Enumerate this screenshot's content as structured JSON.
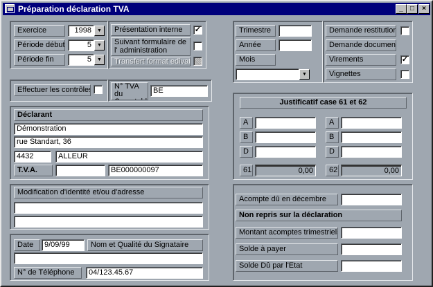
{
  "window": {
    "title": "Préparation déclaration TVA",
    "controls": {
      "minimize": "_",
      "maximize": "□",
      "close": "×"
    }
  },
  "periode": {
    "exercice_label": "Exercice",
    "exercice_value": "1998",
    "debut_label": "Période début",
    "debut_value": "5",
    "fin_label": "Période fin",
    "fin_value": "5"
  },
  "options": {
    "presentation_label": "Présentation interne",
    "presentation_checked": "✓",
    "suivant_label": "Suivant formulaire de l' administration",
    "suivant_checked": "",
    "transfert_label": "Transfert format edivat",
    "transfert_checked": ""
  },
  "controles": {
    "label": "Effectuer les contrôles",
    "checked": ""
  },
  "comptable": {
    "label": "N° TVA du Comptable",
    "value": "BE"
  },
  "declarant": {
    "heading": "Déclarant",
    "nom": "Démonstration",
    "rue": "rue Standart, 36",
    "cp": "4432",
    "localite": "ALLEUR",
    "tva_label": "T.V.A.",
    "tva_prefix": "",
    "tva_number": "BE000000097"
  },
  "modification": {
    "label": "Modification d'identité et/ou d'adresse",
    "line1": "",
    "line2": ""
  },
  "signataire": {
    "date_label": "Date",
    "date_value": "9/09/99",
    "nom_label": "Nom et Qualité du Signataire",
    "nom_value": "",
    "tel_label": "N° de Téléphone",
    "tel_value": "04/123.45.67"
  },
  "periode_trim": {
    "trimestre_label": "Trimestre",
    "trimestre_value": "",
    "annee_label": "Année",
    "annee_value": "",
    "mois_label": "Mois",
    "mois_value": ""
  },
  "demandes": {
    "restitution_label": "Demande  restitution",
    "restitution_checked": "",
    "documents_label": "Demande documents",
    "virements_label": "Virements",
    "virements_checked": "✓",
    "vignettes_label": "Vignettes",
    "vignettes_checked": ""
  },
  "justificatif": {
    "heading": "Justificatif case 61 et 62",
    "left": {
      "a": "A",
      "b": "B",
      "d": "D",
      "a_value": "",
      "b_value": "",
      "d_value": "",
      "total_label": "61",
      "total_value": "0,00"
    },
    "right": {
      "a": "A",
      "b": "B",
      "d": "D",
      "a_value": "",
      "b_value": "",
      "d_value": "",
      "total_label": "62",
      "total_value": "0,00"
    }
  },
  "acompte": {
    "decembre_label": "Acompte dû en décembre",
    "decembre_value": "",
    "non_repris": "Non repris sur la déclaration",
    "trimestriels_label": "Montant acomptes trimestriels",
    "trimestriels_value": "",
    "solde_payer_label": "Solde à payer",
    "solde_payer_value": "",
    "solde_etat_label": "Solde Dû par l'Etat",
    "solde_etat_value": ""
  }
}
